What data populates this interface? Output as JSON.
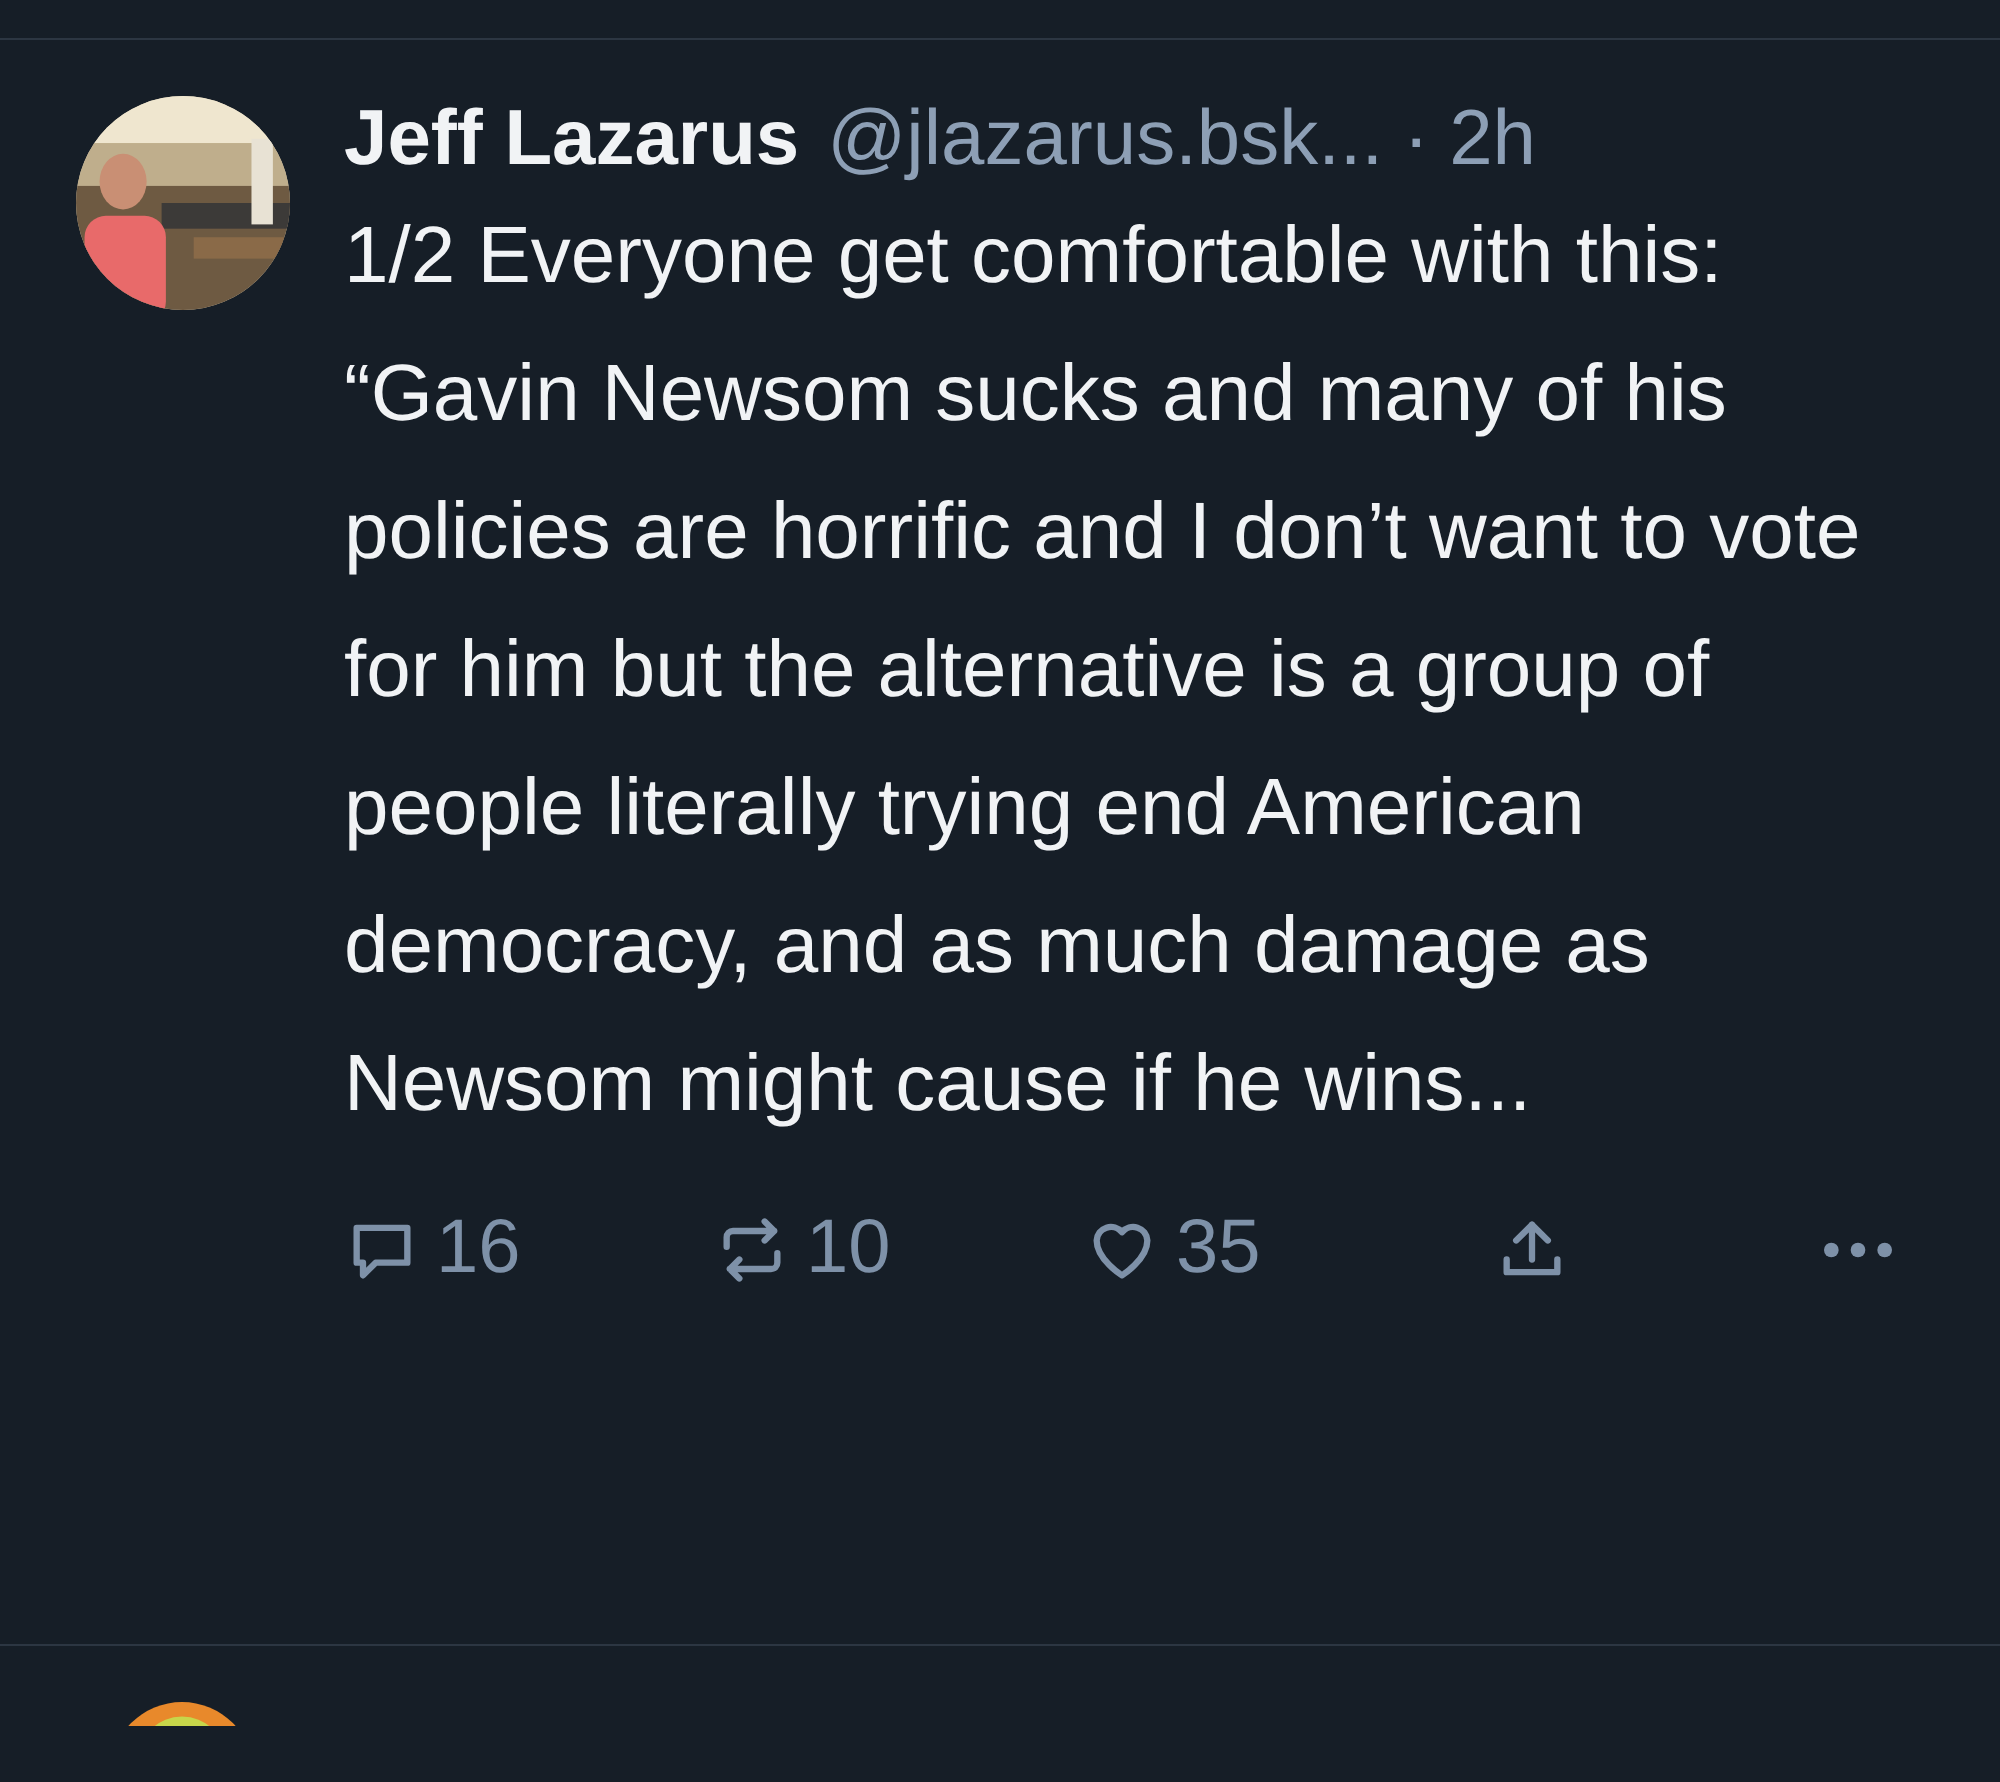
{
  "post": {
    "author": "Jeff Lazarus",
    "handle": "@jlazarus.bsk...",
    "separator": "·",
    "time": "2h",
    "text": "1/2 Everyone get comfortable with this: “Gavin Newsom sucks and many of his policies are horrific and I don’t want to vote for him but the alternative is a group of people literally trying end American democracy, and as much damage as Newsom might cause if he wins...",
    "actions": [
      {
        "kind": "reply",
        "count": "16"
      },
      {
        "kind": "repost",
        "count": "10"
      },
      {
        "kind": "like",
        "count": "35"
      },
      {
        "kind": "share"
      },
      {
        "kind": "more"
      }
    ]
  }
}
